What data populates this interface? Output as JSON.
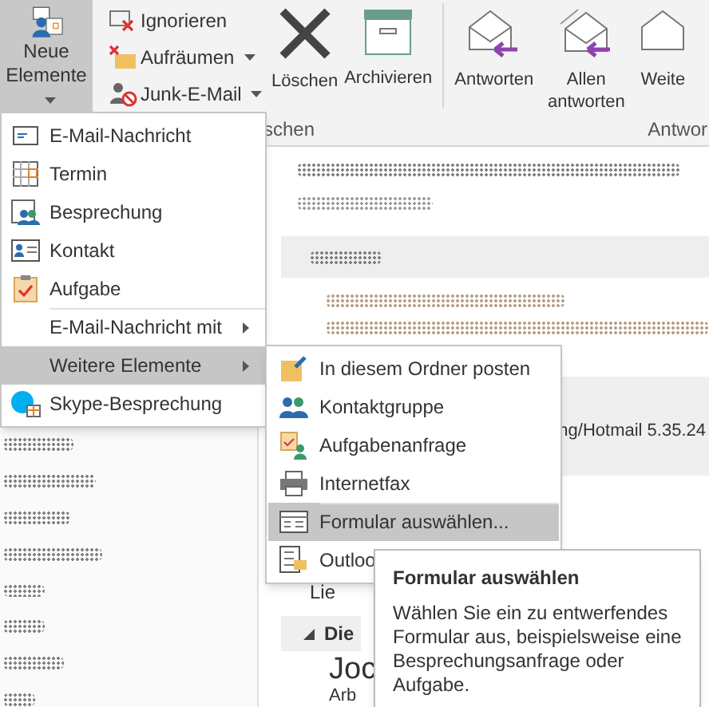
{
  "ribbon": {
    "new_items": {
      "label": "Neue Elemente",
      "pressed": true
    },
    "small_buttons": [
      {
        "label": "Ignorieren",
        "kind": "ignore",
        "dropdown": false
      },
      {
        "label": "Aufräumen",
        "kind": "cleanup",
        "dropdown": true
      },
      {
        "label": "Junk-E-Mail",
        "kind": "junk",
        "dropdown": true
      }
    ],
    "large_buttons": [
      {
        "label": "Löschen",
        "kind": "delete"
      },
      {
        "label": "Archivieren",
        "kind": "archive"
      }
    ],
    "respond_buttons": [
      {
        "label": "Antworten",
        "kind": "reply"
      },
      {
        "label": "Allen antworten",
        "kind": "reply_all"
      },
      {
        "label": "Weite",
        "kind": "forward"
      }
    ],
    "group_labels": [
      "schen",
      "Antwor"
    ]
  },
  "menu": {
    "items": [
      {
        "label": "E-Mail-Nachricht",
        "kind": "mail",
        "submenu": false,
        "separator_before": false,
        "selected": false
      },
      {
        "label": "Termin",
        "kind": "calendar",
        "submenu": false,
        "separator_before": false,
        "selected": false
      },
      {
        "label": "Besprechung",
        "kind": "meeting",
        "submenu": false,
        "separator_before": false,
        "selected": false
      },
      {
        "label": "Kontakt",
        "kind": "contact",
        "submenu": false,
        "separator_before": false,
        "selected": false
      },
      {
        "label": "Aufgabe",
        "kind": "task",
        "submenu": false,
        "separator_before": false,
        "selected": false
      },
      {
        "label": "E-Mail-Nachricht mit",
        "kind": "none",
        "submenu": true,
        "separator_before": true,
        "selected": false
      },
      {
        "label": "Weitere Elemente",
        "kind": "none",
        "submenu": true,
        "separator_before": false,
        "selected": true
      },
      {
        "label": "Skype-Besprechung",
        "kind": "skype",
        "submenu": false,
        "separator_before": false,
        "selected": false
      }
    ]
  },
  "submenu": {
    "items": [
      {
        "label": "In diesem Ordner posten",
        "kind": "post",
        "separator_before": false,
        "selected": false
      },
      {
        "label": "Kontaktgruppe",
        "kind": "group",
        "separator_before": false,
        "selected": false
      },
      {
        "label": "Aufgabenanfrage",
        "kind": "task_request",
        "separator_before": false,
        "selected": false
      },
      {
        "label": "Internetfax",
        "kind": "fax",
        "separator_before": false,
        "selected": false
      },
      {
        "label": "Formular auswählen...",
        "kind": "form",
        "separator_before": true,
        "selected": true
      },
      {
        "label": "Outloo",
        "kind": "outlook_form",
        "separator_before": false,
        "selected": false
      }
    ]
  },
  "tooltip": {
    "title": "Formular auswählen",
    "text": "Wählen Sie ein zu entwerfendes Formular aus, beispielsweise eine Besprechungsanfrage oder Aufgabe."
  },
  "reading_pane": {
    "header_text": "ng/Hotmail 5.35.24",
    "body_fragment": "Lie",
    "section": {
      "label": "Die",
      "expanded": true
    },
    "sender": "Joc",
    "sender_detail": "Arb"
  }
}
